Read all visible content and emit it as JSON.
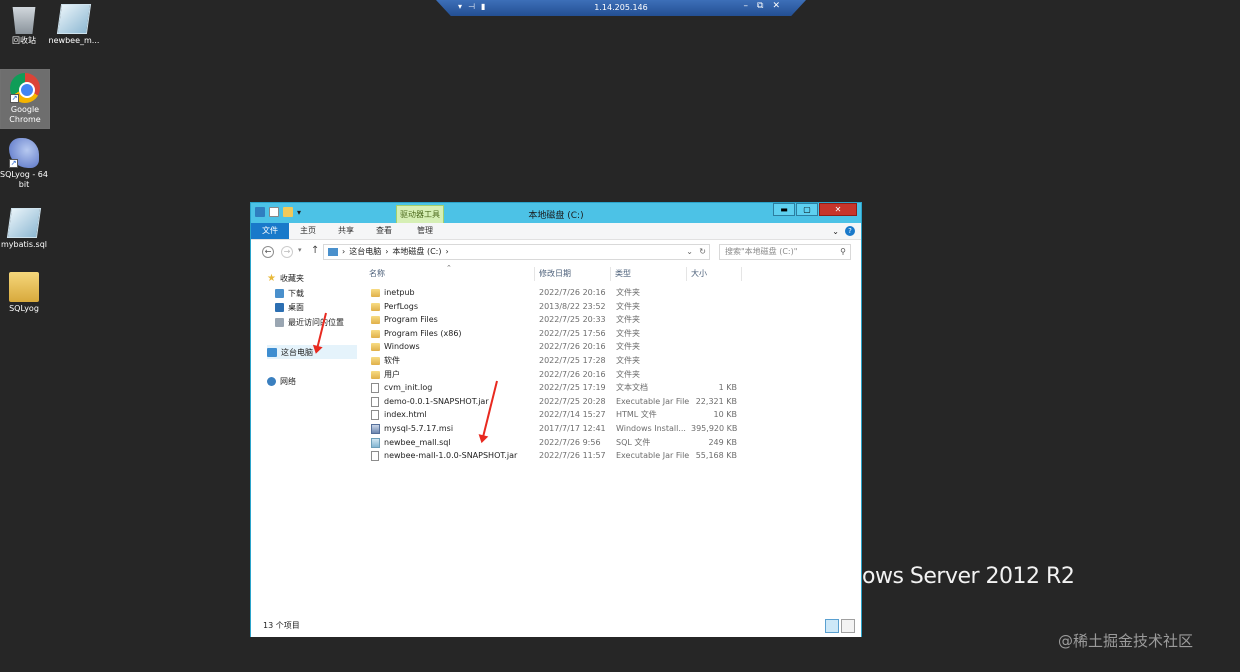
{
  "remote_bar": {
    "title": "1.14.205.146"
  },
  "desktop": {
    "icons": [
      {
        "label": "回收站",
        "icon": "recycle-bin-icon"
      },
      {
        "label": "newbee_m...",
        "icon": "sql-file-icon"
      },
      {
        "label": "Google Chrome",
        "icon": "chrome-icon"
      },
      {
        "label": "SQLyog - 64 bit",
        "icon": "sqlyog-icon"
      },
      {
        "label": "mybatis.sql",
        "icon": "sql-file-icon"
      },
      {
        "label": "SQLyog",
        "icon": "folder-icon"
      }
    ],
    "os_watermark": "ows Server 2012 R2",
    "site_watermark": "@稀土掘金技术社区"
  },
  "explorer": {
    "title": "本地磁盘 (C:)",
    "context_tab": "驱动器工具",
    "ribbon_tabs": [
      "文件",
      "主页",
      "共享",
      "查看",
      "管理"
    ],
    "breadcrumb": [
      "这台电脑",
      "本地磁盘 (C:)"
    ],
    "search_placeholder": "搜索\"本地磁盘 (C:)\"",
    "nav": {
      "favorites": "收藏夹",
      "downloads": "下载",
      "desktop": "桌面",
      "recent": "最近访问的位置",
      "this_pc": "这台电脑",
      "network": "网络"
    },
    "columns": {
      "name": "名称",
      "date": "修改日期",
      "type": "类型",
      "size": "大小"
    },
    "files": [
      {
        "name": "inetpub",
        "date": "2022/7/26 20:16",
        "type": "文件夹",
        "size": "",
        "kind": "folder"
      },
      {
        "name": "PerfLogs",
        "date": "2013/8/22 23:52",
        "type": "文件夹",
        "size": "",
        "kind": "folder"
      },
      {
        "name": "Program Files",
        "date": "2022/7/25 20:33",
        "type": "文件夹",
        "size": "",
        "kind": "folder"
      },
      {
        "name": "Program Files (x86)",
        "date": "2022/7/25 17:56",
        "type": "文件夹",
        "size": "",
        "kind": "folder"
      },
      {
        "name": "Windows",
        "date": "2022/7/26 20:16",
        "type": "文件夹",
        "size": "",
        "kind": "folder"
      },
      {
        "name": "软件",
        "date": "2022/7/25 17:28",
        "type": "文件夹",
        "size": "",
        "kind": "folder"
      },
      {
        "name": "用户",
        "date": "2022/7/26 20:16",
        "type": "文件夹",
        "size": "",
        "kind": "folder"
      },
      {
        "name": "cvm_init.log",
        "date": "2022/7/25 17:19",
        "type": "文本文档",
        "size": "1 KB",
        "kind": "file"
      },
      {
        "name": "demo-0.0.1-SNAPSHOT.jar",
        "date": "2022/7/25 20:28",
        "type": "Executable Jar File",
        "size": "22,321 KB",
        "kind": "file"
      },
      {
        "name": "index.html",
        "date": "2022/7/14 15:27",
        "type": "HTML 文件",
        "size": "10 KB",
        "kind": "file"
      },
      {
        "name": "mysql-5.7.17.msi",
        "date": "2017/7/17 12:41",
        "type": "Windows Install...",
        "size": "395,920 KB",
        "kind": "msi"
      },
      {
        "name": "newbee_mall.sql",
        "date": "2022/7/26 9:56",
        "type": "SQL 文件",
        "size": "249 KB",
        "kind": "sql"
      },
      {
        "name": "newbee-mall-1.0.0-SNAPSHOT.jar",
        "date": "2022/7/26 11:57",
        "type": "Executable Jar File",
        "size": "55,168 KB",
        "kind": "file"
      }
    ],
    "status": "13 个项目"
  },
  "colors": {
    "window_frame": "#4cc2e6",
    "file_tab": "#1979ca",
    "annotation_arrow": "#e8291f"
  }
}
